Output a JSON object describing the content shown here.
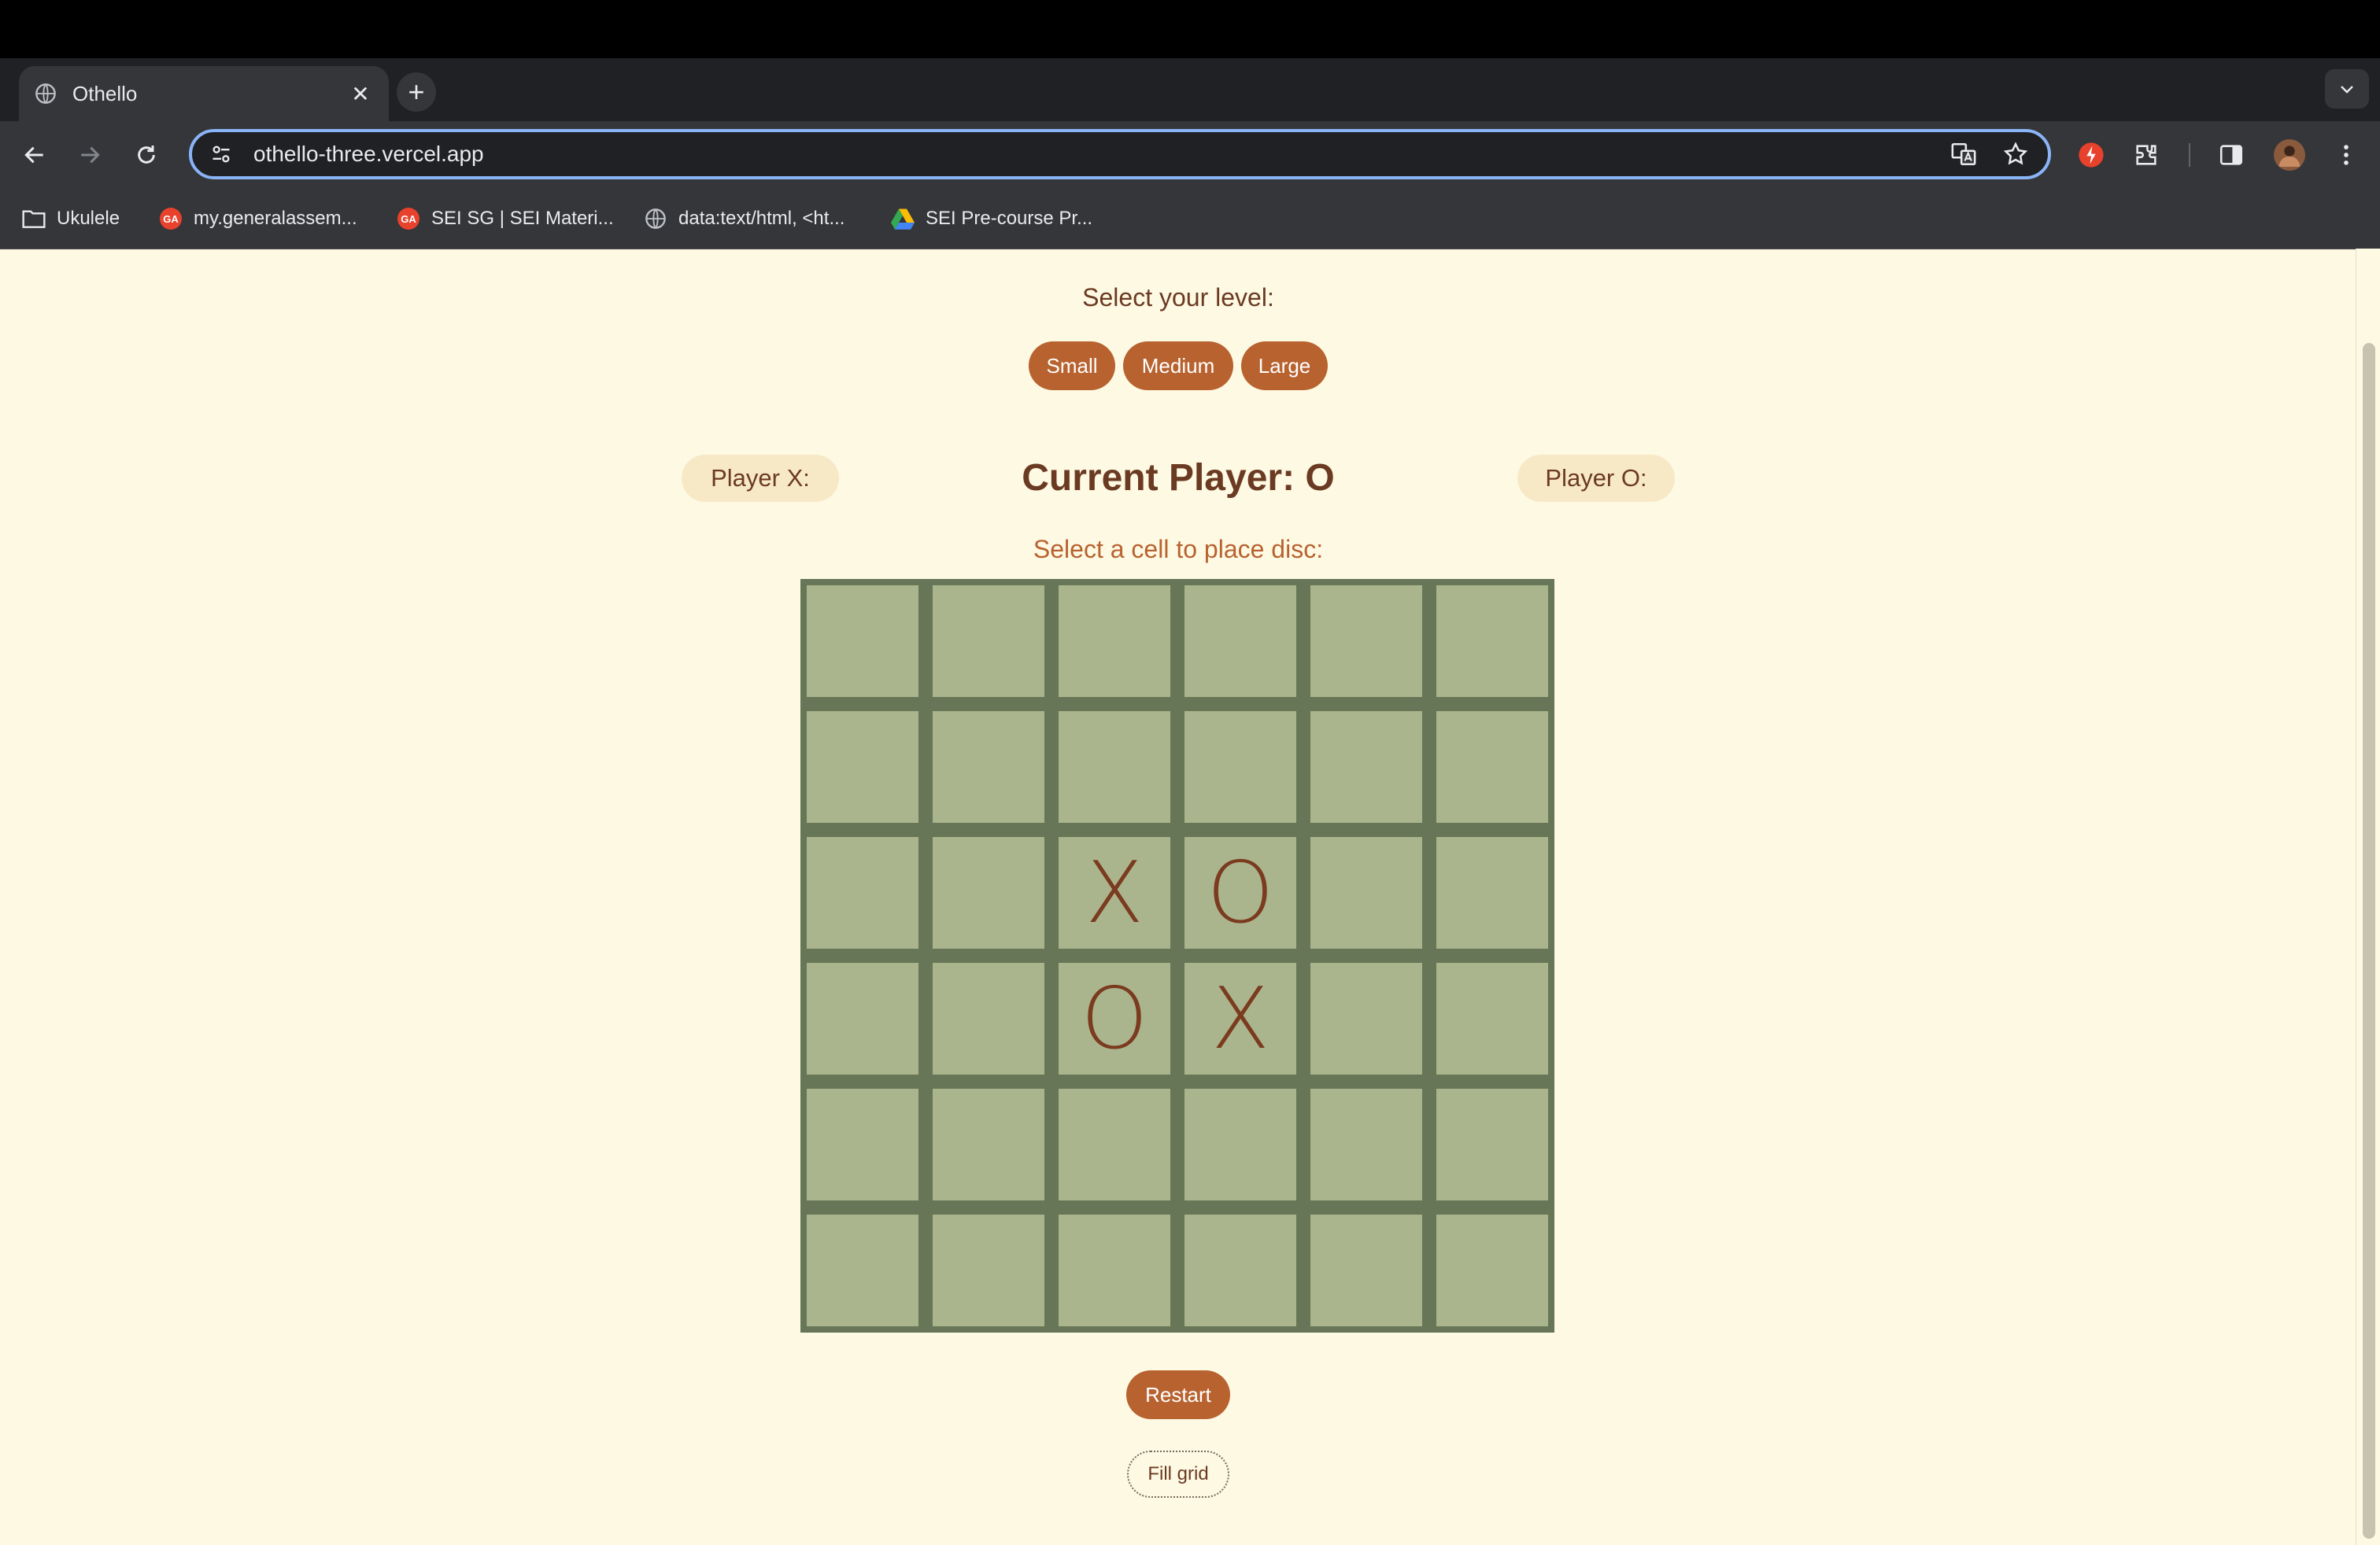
{
  "browser": {
    "tab_title": "Othello",
    "tab_close": "✕",
    "new_tab": "+",
    "url": "othello-three.vercel.app",
    "bookmarks": [
      {
        "label": "Ukulele",
        "icon": "folder-icon"
      },
      {
        "label": "my.generalassem...",
        "icon": "ga-icon"
      },
      {
        "label": "SEI SG | SEI Materi...",
        "icon": "ga-icon"
      },
      {
        "label": "data:text/html, <ht...",
        "icon": "globe-icon"
      },
      {
        "label": "SEI Pre-course Pr...",
        "icon": "google-drive-icon"
      }
    ],
    "ga_logo_text": "GA"
  },
  "game": {
    "level_label": "Select your level:",
    "levels": [
      "Small",
      "Medium",
      "Large"
    ],
    "player_x_label": "Player X:",
    "player_o_label": "Player O:",
    "current_player": "Current Player: O",
    "select_message": "Select a cell to place disc:",
    "board": [
      [
        "",
        "",
        "",
        "",
        "",
        ""
      ],
      [
        "",
        "",
        "",
        "",
        "",
        ""
      ],
      [
        "",
        "",
        "X",
        "O",
        "",
        ""
      ],
      [
        "",
        "",
        "O",
        "X",
        "",
        ""
      ],
      [
        "",
        "",
        "",
        "",
        "",
        ""
      ],
      [
        "",
        "",
        "",
        "",
        "",
        ""
      ]
    ],
    "restart_label": "Restart",
    "fill_grid_label": "Fill grid"
  },
  "colors": {
    "page_bg": "#fdf9e3",
    "accent": "#b8622f",
    "board_border": "#667656",
    "cell": "#abb58d",
    "mark": "#7a3b1f"
  }
}
